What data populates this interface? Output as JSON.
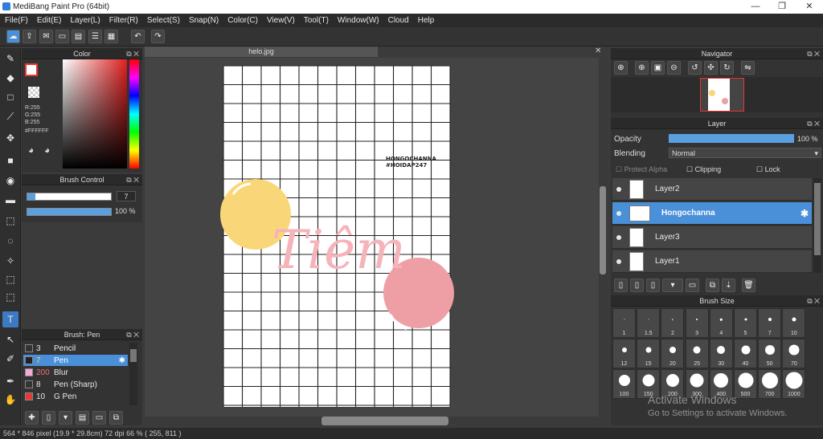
{
  "app": {
    "title": "MediBang Paint Pro (64bit)"
  },
  "menu": [
    "File(F)",
    "Edit(E)",
    "Layer(L)",
    "Filter(R)",
    "Select(S)",
    "Snap(N)",
    "Color(C)",
    "View(V)",
    "Tool(T)",
    "Window(W)",
    "Cloud",
    "Help"
  ],
  "color_panel": {
    "title": "Color",
    "r": "R:255",
    "g": "G:255",
    "b": "B:255",
    "hex": "#FFFFFF"
  },
  "brush_control": {
    "title": "Brush Control",
    "size": "7",
    "opacity": "100 %"
  },
  "brush_list": {
    "title": "Brush: Pen",
    "items": [
      {
        "size": "3",
        "name": "Pencil",
        "color": "#333333"
      },
      {
        "size": "7",
        "name": "Pen",
        "color": "#222222"
      },
      {
        "size": "200",
        "name": "Blur",
        "color": "#f4a9d8"
      },
      {
        "size": "8",
        "name": "Pen (Sharp)",
        "color": "#333333"
      },
      {
        "size": "10",
        "name": "G Pen",
        "color": "#e53935"
      }
    ]
  },
  "document": {
    "tab": "helo.jpg",
    "sign_line1": "HONGOCHANNA",
    "sign_line2": "#HOIDAP247",
    "word": "Tiêm"
  },
  "navigator": {
    "title": "Navigator"
  },
  "layer_panel": {
    "title": "Layer",
    "opacity_label": "Opacity",
    "opacity_value": "100 %",
    "blending_label": "Blending",
    "blending_value": "Normal",
    "protect_alpha": "Protect Alpha",
    "clipping": "Clipping",
    "lock": "Lock",
    "layers": [
      {
        "name": "Layer2"
      },
      {
        "name": "Hongochanna"
      },
      {
        "name": "Layer3"
      },
      {
        "name": "Layer1"
      }
    ]
  },
  "brush_size": {
    "title": "Brush Size",
    "sizes": [
      "1",
      "1.5",
      "2",
      "3",
      "4",
      "5",
      "7",
      "10",
      "12",
      "15",
      "20",
      "25",
      "30",
      "40",
      "50",
      "70",
      "100",
      "150",
      "200",
      "300",
      "400",
      "500",
      "700",
      "1000"
    ]
  },
  "watermark": {
    "line1": "Activate Windows",
    "line2": "Go to Settings to activate Windows."
  },
  "status": {
    "text": "564 * 846 pixel   (19.9 * 29.8cm)   72 dpi   66 %   ( 255, 811 )"
  }
}
